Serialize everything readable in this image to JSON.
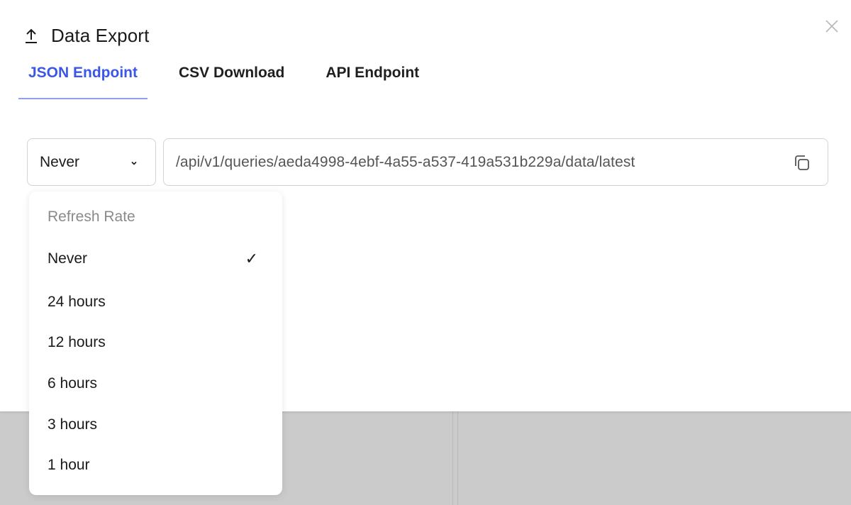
{
  "modal": {
    "title": "Data Export",
    "tabs": [
      {
        "label": "JSON Endpoint",
        "active": true
      },
      {
        "label": "CSV Download",
        "active": false
      },
      {
        "label": "API Endpoint",
        "active": false
      }
    ],
    "refresh_select": {
      "value": "Never"
    },
    "endpoint_url": "/api/v1/queries/aeda4998-4ebf-4a55-a537-419a531b229a/data/latest"
  },
  "dropdown": {
    "header": "Refresh Rate",
    "options": [
      {
        "label": "Never",
        "selected": true
      },
      {
        "label": "24 hours",
        "selected": false
      },
      {
        "label": "12 hours",
        "selected": false
      },
      {
        "label": "6 hours",
        "selected": false
      },
      {
        "label": "3 hours",
        "selected": false
      },
      {
        "label": "1 hour",
        "selected": false
      }
    ],
    "check_glyph": "✓"
  },
  "colors": {
    "accent": "#3b57e8",
    "tab_underline": "#8ea0ee",
    "backdrop": "#cbcbcb"
  },
  "icons": {
    "export": "upload-arrow-icon",
    "close": "close-icon",
    "chevron": "chevron-down-icon",
    "copy": "copy-icon"
  }
}
